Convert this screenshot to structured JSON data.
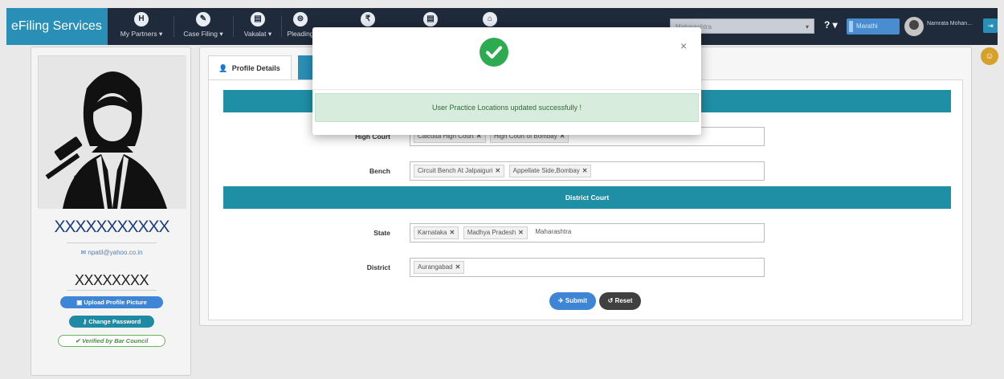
{
  "navbar": {
    "brand": "eFiling Services",
    "items": [
      {
        "label": "My Partners",
        "caret": "▾",
        "icon_char": "H"
      },
      {
        "label": "Case Filing",
        "caret": "▾",
        "icon_char": "✎"
      },
      {
        "label": "Vakalat",
        "caret": "▾",
        "icon_char": "▤"
      },
      {
        "label": "Pleading",
        "caret": "",
        "icon_char": "⊜"
      },
      {
        "label": "",
        "caret": "",
        "icon_char": "₹"
      },
      {
        "label": "",
        "caret": "",
        "icon_char": "▤"
      },
      {
        "label": "",
        "caret": "",
        "icon_char": "⌂"
      }
    ],
    "state_select": {
      "value": "Maharashtra",
      "caret": "▾"
    },
    "help_label": "? ▾",
    "language_button": "Marathi",
    "user_name": "Namrata Mohan...",
    "logout_icon": "⇥"
  },
  "float_badge_icon": "☺",
  "profile": {
    "name": "XXXXXXXXXXX",
    "email_icon": "✉",
    "email": "npatil@yahoo.co.in",
    "id_text": "XXXXXXXX",
    "upload_button": "Upload Profile Picture",
    "upload_icon": "▣",
    "change_password_button": "Change Password",
    "password_icon": "⚷",
    "verified_badge": "Verified by Bar Council",
    "verified_icon": "✔"
  },
  "tabs": {
    "profile_details": "Profile Details",
    "profile_icon": "👤"
  },
  "form": {
    "high_court_label": "High Court",
    "high_court_values": [
      "Calcutta High Court",
      "High Court of Bombay"
    ],
    "bench_label": "Bench",
    "bench_values": [
      "Circuit Bench At Jalpaiguri",
      "Appellate Side,Bombay"
    ],
    "district_court_heading": "District Court",
    "state_label": "State",
    "state_values": [
      "Karnataka",
      "Madhya Pradesh"
    ],
    "state_typing": "Maharashtra",
    "district_label": "District",
    "district_values": [
      "Aurangabad"
    ],
    "chip_remove": "✕",
    "submit_button": "Submit",
    "submit_icon": "✈",
    "reset_button": "Reset",
    "reset_icon": "↺"
  },
  "modal": {
    "close": "×",
    "message": "User Practice Locations updated successfully !"
  },
  "colors": {
    "navbar": "#1f2a3a",
    "brand": "#2a8fb6",
    "section_bar": "#1f8fa6",
    "success": "#2eab51",
    "primary_button": "#3f85d6"
  }
}
